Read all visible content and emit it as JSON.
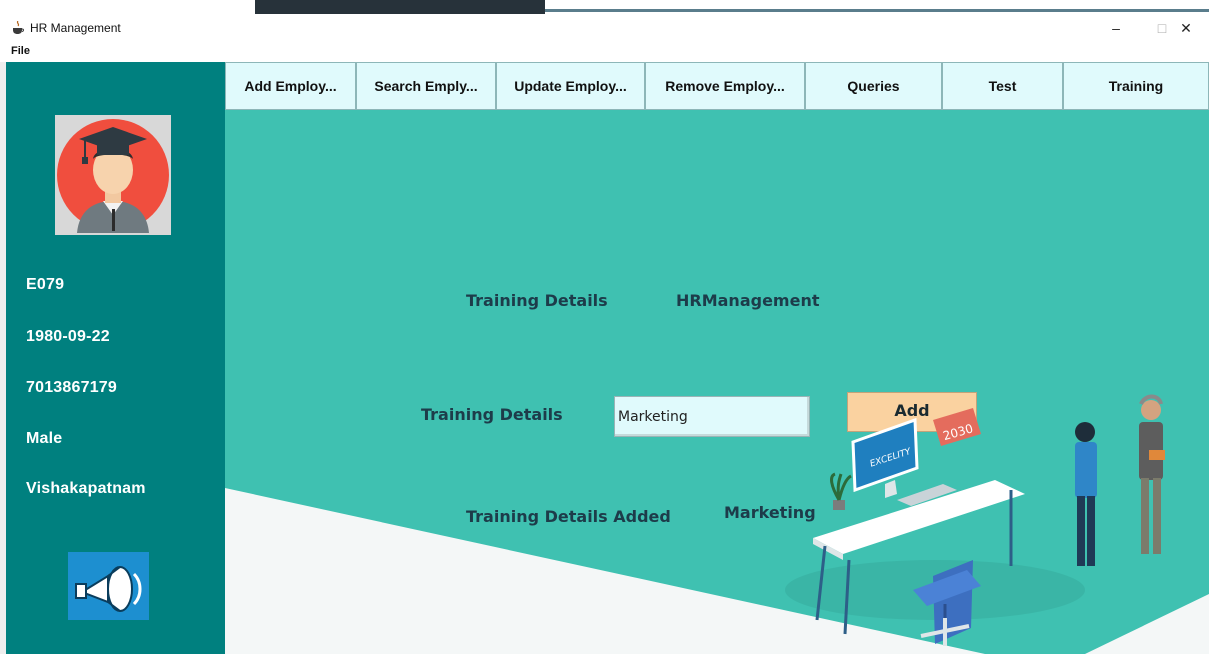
{
  "window": {
    "title": "HR Management",
    "minimize_glyph": "–",
    "maximize_glyph": "□",
    "close_glyph": "✕"
  },
  "menu": {
    "file": "File"
  },
  "sidebar": {
    "employee_id": "E079",
    "dob": "1980-09-22",
    "phone": "7013867179",
    "gender": "Male",
    "city": "Vishakapatnam"
  },
  "tabs": [
    {
      "label": "Add Employ..."
    },
    {
      "label": "Search Emply..."
    },
    {
      "label": "Update Employ..."
    },
    {
      "label": "Remove Employ..."
    },
    {
      "label": "Queries"
    },
    {
      "label": "Test"
    },
    {
      "label": "Training"
    }
  ],
  "training": {
    "heading_left": "Training Details",
    "heading_right": "HRManagement",
    "field_label": "Training Details",
    "field_value": "Marketing",
    "add_label": "Add",
    "result_label": "Training Details Added",
    "result_value": "Marketing"
  },
  "illustration": {
    "screen_text": "EXCELITY",
    "calendar_text": "2030"
  },
  "colors": {
    "sidebar": "#00807f",
    "content": "#3fc1b1",
    "tab": "#e0fafc",
    "add_button": "#fad2a0"
  }
}
